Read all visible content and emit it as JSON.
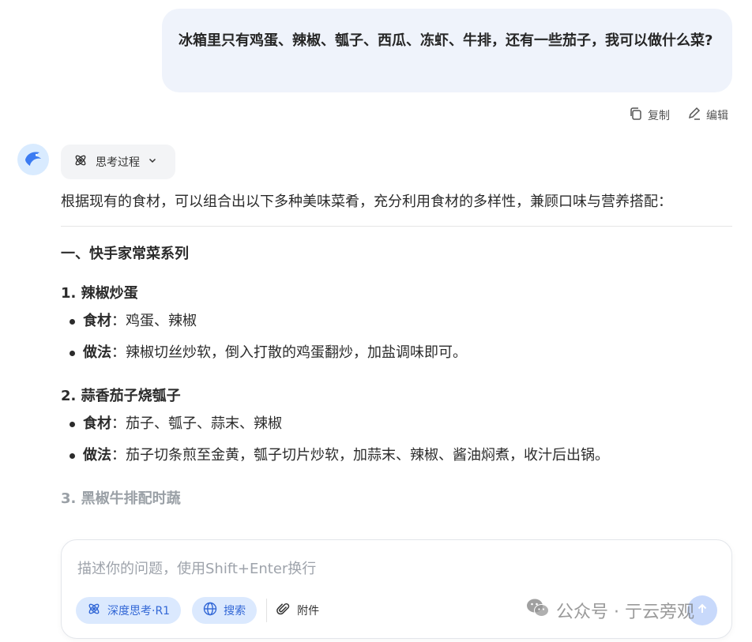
{
  "user_message": {
    "text": "冰箱里只有鸡蛋、辣椒、瓠子、西瓜、冻虾、牛排，还有一些茄子，我可以做什么菜?",
    "copy_label": "复制",
    "edit_label": "编辑"
  },
  "assistant": {
    "thinking_label": "思考过程",
    "intro": "根据现有的食材，可以组合出以下多种美味菜肴，充分利用食材的多样性，兼顾口味与营养搭配：",
    "section_title": "一、快手家常菜系列",
    "dishes": [
      {
        "title": "1. 辣椒炒蛋",
        "ingredients_label": "食材",
        "ingredients": "：鸡蛋、辣椒",
        "method_label": "做法",
        "method": "：辣椒切丝炒软，倒入打散的鸡蛋翻炒，加盐调味即可。"
      },
      {
        "title": "2. 蒜香茄子烧瓠子",
        "ingredients_label": "食材",
        "ingredients": "：茄子、瓠子、蒜末、辣椒",
        "method_label": "做法",
        "method": "：茄子切条煎至金黄，瓠子切片炒软，加蒜末、辣椒、酱油焖煮，收汁后出锅。"
      }
    ],
    "next_dish_title": "3. 黑椒牛排配时蔬"
  },
  "composer": {
    "placeholder": "描述你的问题，使用Shift+Enter换行",
    "deep_think_label": "深度思考·R1",
    "search_label": "搜索",
    "attach_label": "附件"
  },
  "watermark": {
    "text": "公众号 · 亍云旁观"
  },
  "colors": {
    "accent": "#3267d6",
    "bubble_bg": "#eff3fb",
    "pill_bg": "#dbe9fe"
  },
  "icons": {
    "copy": "copy-icon",
    "edit": "edit-icon",
    "avatar": "whale-logo-icon",
    "thinking": "atom-icon",
    "chevron": "chevron-down-icon",
    "search": "globe-icon",
    "attach": "paperclip-icon",
    "send": "send-arrow-icon",
    "wechat": "wechat-icon"
  }
}
